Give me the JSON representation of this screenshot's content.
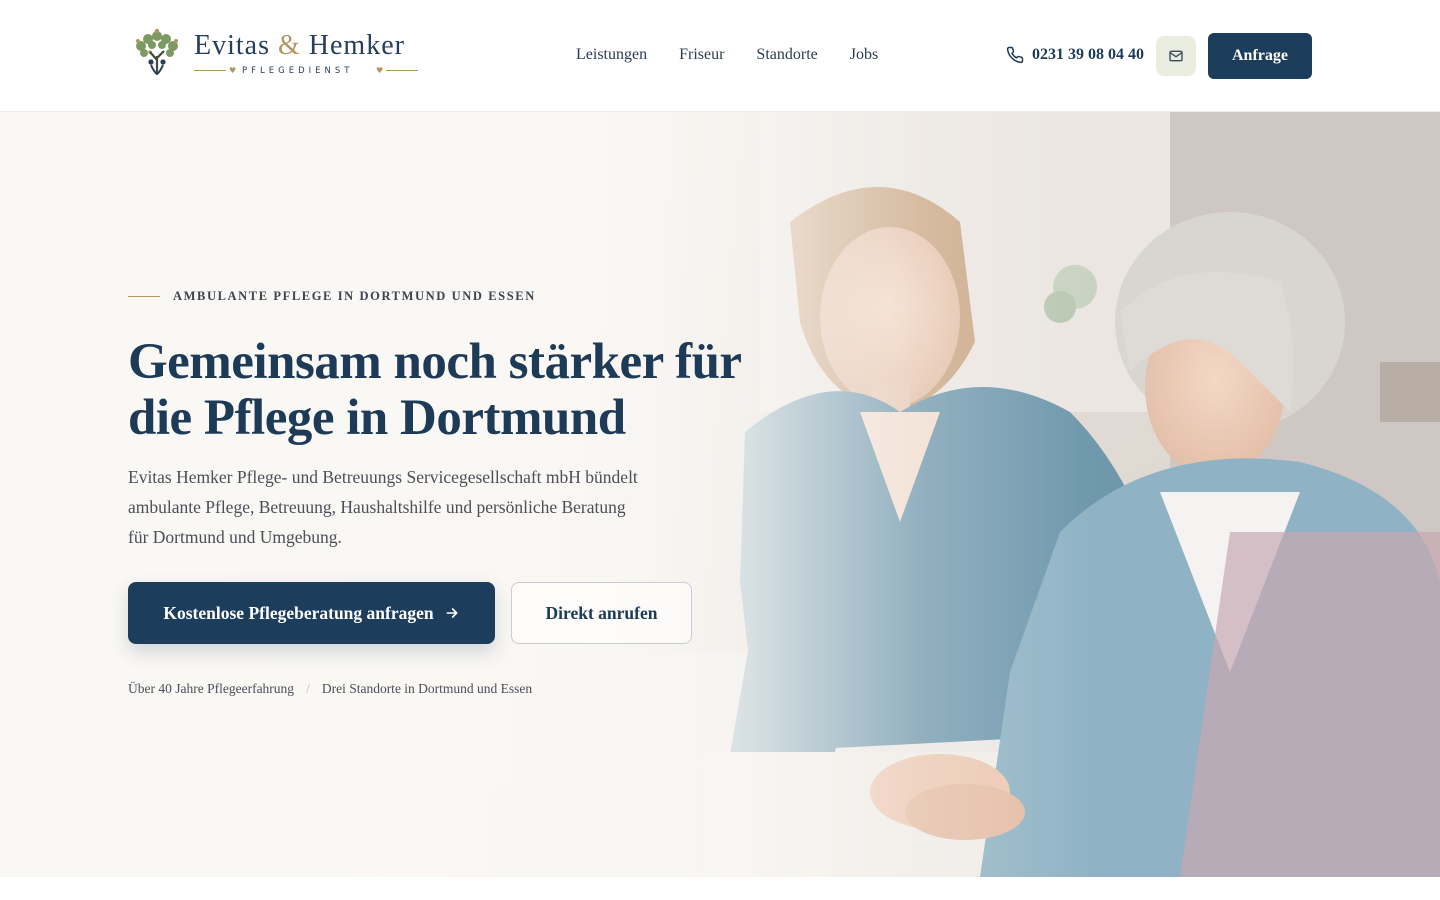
{
  "header": {
    "logo": {
      "title_part1": "Evitas",
      "title_amp": "&",
      "title_part2": "Hemker",
      "subtitle": "PFLEGEDIENST"
    },
    "nav": [
      "Leistungen",
      "Friseur",
      "Standorte",
      "Jobs"
    ],
    "phone": "0231 39 08 04 40",
    "mail_icon": "mail-icon",
    "cta_label": "Anfrage"
  },
  "hero": {
    "eyebrow": "AMBULANTE PFLEGE IN DORTMUND UND ESSEN",
    "title": "Gemeinsam noch stärker für die Pflege in Dortmund",
    "lead": "Evitas Hemker Pflege- und Betreuungs Servicegesellschaft mbH bündelt ambulante Pflege, Betreuung, Haushaltshilfe und persönliche Beratung für Dortmund und Umgebung.",
    "primary_button": "Kostenlose Pflegeberatung anfragen",
    "secondary_button": "Direkt anrufen",
    "facts": [
      "Über 40 Jahre Pflegeerfahrung",
      "Drei Standorte in Dortmund und Essen"
    ],
    "fact_separator": "/"
  },
  "colors": {
    "primary": "#1d3d5c",
    "accent_gold": "#b3955e",
    "mail_button_bg": "#e9ede0"
  }
}
